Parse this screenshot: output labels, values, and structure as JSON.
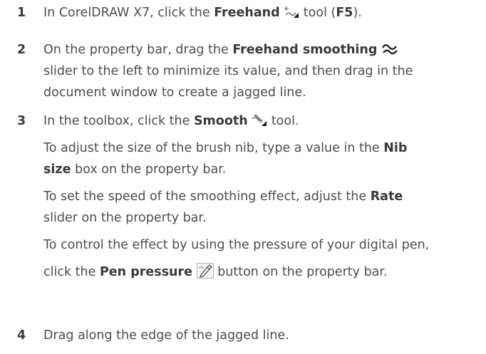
{
  "steps": [
    {
      "number": "1",
      "lines": [
        {
          "t1": "In CorelDRAW X7, click the ",
          "b1": "Freehand",
          "t2": " tool (",
          "b2": "F5",
          "t3": ")."
        }
      ],
      "icon": "freehand-tool-icon"
    },
    {
      "number": "2",
      "lines": [
        {
          "t1": "On the property bar, drag the ",
          "b1": "Freehand smoothing"
        },
        {
          "t1": "slider to the left to minimize its value, and then drag in the"
        },
        {
          "t1": "document window to create a jagged line."
        }
      ],
      "icon": "freehand-smoothing-icon"
    },
    {
      "number": "3",
      "lines": [
        {
          "t1": "In the toolbox, click the ",
          "b1": "Smooth",
          "t2": " tool."
        }
      ],
      "icon": "smooth-tool-icon",
      "tips": [
        {
          "line1": {
            "t1": "To adjust the size of the brush nib, type a value in the ",
            "b1": "Nib"
          },
          "line2": {
            "b1": "size",
            "t1": " box on the property bar."
          }
        },
        {
          "line1": {
            "t1": "To set the speed of the smoothing effect, adjust the ",
            "b1": "Rate"
          },
          "line2": {
            "t1": "slider on the property bar."
          }
        },
        {
          "line1": {
            "t1": "To control the effect by using the pressure of your digital pen,"
          },
          "line2": {
            "t1": "click the ",
            "b1": "Pen pressure",
            "t2": " button on the property bar."
          }
        }
      ],
      "tip_icon": "pen-pressure-icon"
    },
    {
      "number": "4",
      "lines": [
        {
          "t1": "Drag along the edge of the jagged line."
        }
      ]
    }
  ],
  "colors": {
    "text": "#4d4d4d",
    "bold": "#3a3a3a",
    "icon_accent": "#1a1a1a"
  }
}
